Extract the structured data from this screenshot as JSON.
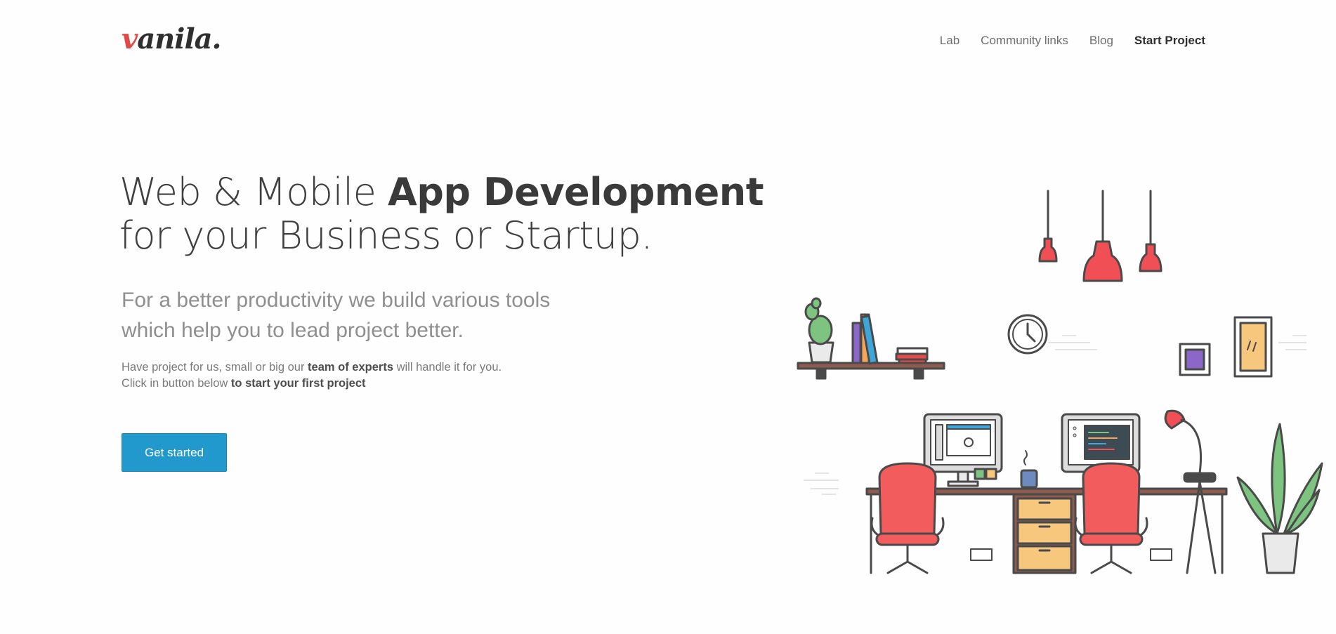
{
  "header": {
    "logo_initial": "v",
    "logo_rest": "anila.",
    "nav": [
      {
        "label": "Lab"
      },
      {
        "label": "Community links"
      },
      {
        "label": "Blog"
      },
      {
        "label": "Start Project"
      }
    ]
  },
  "hero": {
    "title_light_1": "Web & Mobile ",
    "title_bold": "App Development",
    "title_line_2": "for your Business or Startup.",
    "subtitle_line_1": "For a better productivity we build various tools",
    "subtitle_line_2": "which help you to lead project better.",
    "body_1_a": "Have project for us, small or big our ",
    "body_1_b": "team of experts",
    "body_1_c": " will handle it for you.",
    "body_2_a": "Click in button below ",
    "body_2_b": "to start your first project",
    "cta_label": "Get started"
  },
  "colors": {
    "accent": "#2299cc",
    "logo_red": "#e24a4a",
    "chair_red": "#f25c5c",
    "drawer_orange": "#f7c77d"
  }
}
